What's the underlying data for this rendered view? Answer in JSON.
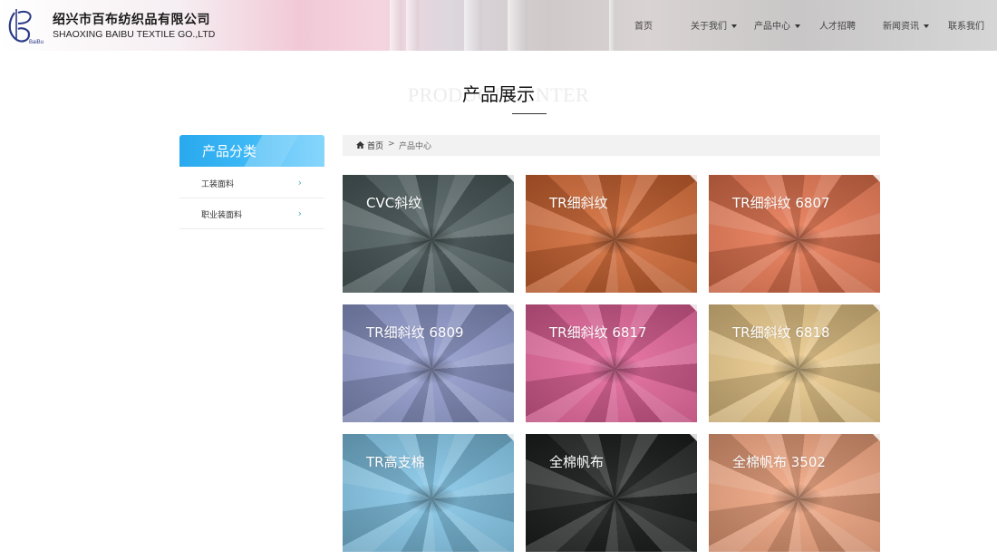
{
  "header": {
    "company_cn": "绍兴市百布纺织品有限公司",
    "company_en": "SHAOXING BAIBU TEXTILE GO.,LTD",
    "logo_text": "BaiBu",
    "nav": [
      {
        "label": "首页",
        "has_dropdown": false
      },
      {
        "label": "关于我们",
        "has_dropdown": true
      },
      {
        "label": "产品中心",
        "has_dropdown": true
      },
      {
        "label": "人才招聘",
        "has_dropdown": false
      },
      {
        "label": "新闻资讯",
        "has_dropdown": true
      },
      {
        "label": "联系我们",
        "has_dropdown": false
      }
    ]
  },
  "page": {
    "title": "产品展示",
    "bg_title": "PRODUCT CENTER"
  },
  "sidebar": {
    "heading": "产品分类",
    "items": [
      {
        "label": "工装面料"
      },
      {
        "label": "职业装面料"
      }
    ]
  },
  "breadcrumb": {
    "home": "首页",
    "separator": ">",
    "current": "产品中心"
  },
  "products": [
    {
      "name": "CVC斜纹",
      "color": "#4b5b5c"
    },
    {
      "name": "TR细斜纹",
      "color": "#d3652f"
    },
    {
      "name": "TR细斜纹 6807",
      "color": "#e8734c"
    },
    {
      "name": "TR细斜纹 6809",
      "color": "#8e99cd"
    },
    {
      "name": "TR细斜纹 6817",
      "color": "#e45f97"
    },
    {
      "name": "TR细斜纹 6818",
      "color": "#ecc987"
    },
    {
      "name": "TR高支棉",
      "color": "#7fc5e8"
    },
    {
      "name": "全棉帆布",
      "color": "#1b1d1c"
    },
    {
      "name": "全棉帆布 3502",
      "color": "#f1a27b"
    }
  ],
  "colors": {
    "accent": "#3fb9f6",
    "breadcrumb_bg": "#f2f2f2"
  }
}
